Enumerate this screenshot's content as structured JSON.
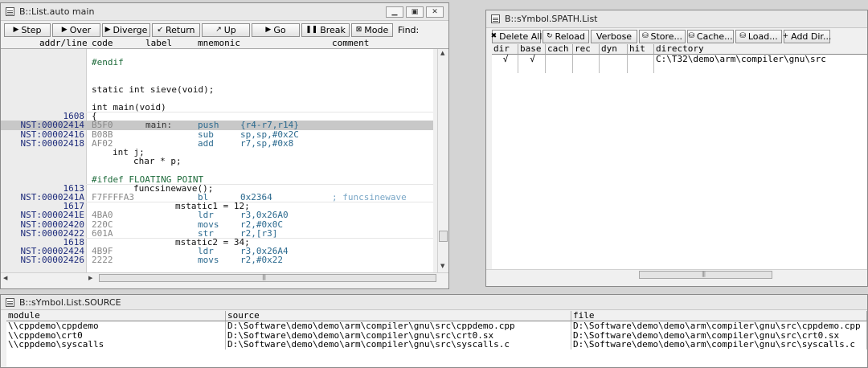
{
  "list_window": {
    "title": "B::List.auto main",
    "toolbar": [
      {
        "label": "Step",
        "icon": "step-icon",
        "glyph": "▶"
      },
      {
        "label": "Over",
        "icon": "step-over-icon",
        "glyph": "▶"
      },
      {
        "label": "Diverge",
        "icon": "diverge-icon",
        "glyph": "▶"
      },
      {
        "label": "Return",
        "icon": "return-icon",
        "glyph": "↙"
      },
      {
        "label": "Up",
        "icon": "up-icon",
        "glyph": "↗"
      },
      {
        "label": "Go",
        "icon": "go-icon",
        "glyph": "▶"
      },
      {
        "label": "Break",
        "icon": "break-icon",
        "glyph": "❚❚"
      },
      {
        "label": "Mode",
        "icon": "mode-icon",
        "glyph": "⊠"
      }
    ],
    "find_label": "Find:",
    "columns": [
      "addr/line",
      "code",
      "label",
      "mnemonic",
      "comment"
    ],
    "lines": [
      {
        "kind": "pre",
        "src": "#endif"
      },
      {
        "kind": "blank"
      },
      {
        "kind": "blank"
      },
      {
        "kind": "src",
        "src": "static int sieve(void);"
      },
      {
        "kind": "blank"
      },
      {
        "kind": "src",
        "src": "int main(void)"
      },
      {
        "kind": "src",
        "addr": "1608",
        "src": "{"
      },
      {
        "kind": "asm",
        "hl": true,
        "addr": "NST:00002414",
        "opc": "B5F0",
        "lbl": "main:",
        "mn": "push",
        "arg": "{r4-r7,r14}"
      },
      {
        "kind": "asm",
        "addr": "NST:00002416",
        "opc": "B08B",
        "mn": "sub",
        "arg": "sp,sp,#0x2C"
      },
      {
        "kind": "asm",
        "addr": "NST:00002418",
        "opc": "AF02",
        "mn": "add",
        "arg": "r7,sp,#0x8"
      },
      {
        "kind": "src",
        "indent": 1,
        "src": "int j;"
      },
      {
        "kind": "src",
        "indent": 2,
        "src": "char * p;"
      },
      {
        "kind": "blank"
      },
      {
        "kind": "pre",
        "src": "#ifdef FLOATING_POINT"
      },
      {
        "kind": "src",
        "addr": "1613",
        "indent": 2,
        "src": "funcsinewave();"
      },
      {
        "kind": "asm",
        "addr": "NST:0000241A",
        "opc": "F7FFFFA3",
        "mn": "bl",
        "arg": "0x2364",
        "cmt": "; funcsinewave"
      },
      {
        "kind": "src",
        "addr": "1617",
        "indent": 4,
        "src": "mstatic1 = 12;"
      },
      {
        "kind": "asm",
        "addr": "NST:0000241E",
        "opc": "4BA0",
        "mn": "ldr",
        "arg": "r3,0x26A0"
      },
      {
        "kind": "asm",
        "addr": "NST:00002420",
        "opc": "220C",
        "mn": "movs",
        "arg": "r2,#0x0C"
      },
      {
        "kind": "asm",
        "addr": "NST:00002422",
        "opc": "601A",
        "mn": "str",
        "arg": "r2,[r3]"
      },
      {
        "kind": "src",
        "addr": "1618",
        "indent": 4,
        "src": "mstatic2 = 34;"
      },
      {
        "kind": "asm",
        "addr": "NST:00002424",
        "opc": "4B9F",
        "mn": "ldr",
        "arg": "r3,0x26A4"
      },
      {
        "kind": "asm",
        "addr": "NST:00002426",
        "opc": "2222",
        "mn": "movs",
        "arg": "r2,#0x22"
      }
    ]
  },
  "spath_window": {
    "title": "B::sYmbol.SPATH.List",
    "toolbar": [
      {
        "label": "Delete All",
        "icon": "delete-all-icon",
        "glyph": "✖"
      },
      {
        "label": "Reload",
        "icon": "reload-icon",
        "glyph": "↻"
      },
      {
        "label": "Verbose",
        "icon": "",
        "glyph": ""
      },
      {
        "label": "Store...",
        "icon": "store-icon",
        "glyph": "⛁"
      },
      {
        "label": "Cache...",
        "icon": "cache-icon",
        "glyph": "⛁"
      },
      {
        "label": "Load...",
        "icon": "load-icon",
        "glyph": "⛁"
      },
      {
        "label": "Add Dir...",
        "icon": "add-dir-icon",
        "glyph": "+"
      }
    ],
    "columns": [
      "dir",
      "base",
      "cach",
      "rec",
      "dyn",
      "hit",
      "directory"
    ],
    "rows": [
      {
        "dir": "√",
        "base": "√",
        "cach": "",
        "rec": "",
        "dyn": "",
        "hit": "",
        "directory": "C:\\T32\\demo\\arm\\compiler\\gnu\\src"
      }
    ]
  },
  "source_window": {
    "title": "B::sYmbol.List.SOURCE",
    "columns": [
      "module",
      "source",
      "file"
    ],
    "rows": [
      {
        "module": "\\\\cppdemo\\cppdemo",
        "source": "D:\\Software\\demo\\demo\\arm\\compiler\\gnu\\src\\cppdemo.cpp",
        "file": "D:\\Software\\demo\\demo\\arm\\compiler\\gnu\\src\\cppdemo.cpp"
      },
      {
        "module": "\\\\cppdemo\\crt0",
        "source": "D:\\Software\\demo\\demo\\arm\\compiler\\gnu\\src\\crt0.sx",
        "file": "D:\\Software\\demo\\demo\\arm\\compiler\\gnu\\src\\crt0.sx"
      },
      {
        "module": "\\\\cppdemo\\syscalls",
        "source": "D:\\Software\\demo\\demo\\arm\\compiler\\gnu\\src\\syscalls.c",
        "file": "D:\\Software\\demo\\demo\\arm\\compiler\\gnu\\src\\syscalls.c"
      }
    ]
  }
}
